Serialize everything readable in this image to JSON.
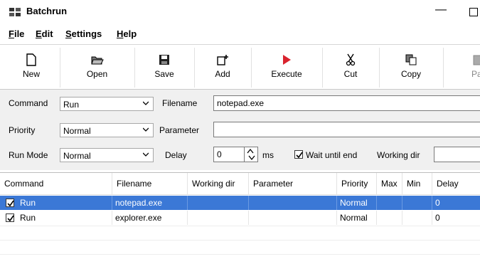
{
  "window": {
    "title": "Batchrun",
    "min_glyph": "—"
  },
  "menu": [
    {
      "label": "File",
      "key": "F",
      "rest": "ile"
    },
    {
      "label": "Edit",
      "key": "E",
      "rest": "dit"
    },
    {
      "label": "Settings",
      "key": "S",
      "rest": "ettings"
    },
    {
      "label": "Help",
      "key": "H",
      "rest": "elp"
    }
  ],
  "toolbar": {
    "new": "New",
    "open": "Open",
    "save": "Save",
    "add": "Add",
    "execute": "Execute",
    "cut": "Cut",
    "copy": "Copy",
    "paste": "Past"
  },
  "form": {
    "command_label": "Command",
    "command_value": "Run",
    "filename_label": "Filename",
    "filename_value": "notepad.exe",
    "priority_label": "Priority",
    "priority_value": "Normal",
    "parameter_label": "Parameter",
    "parameter_value": "",
    "runmode_label": "Run Mode",
    "runmode_value": "Normal",
    "delay_label": "Delay",
    "delay_value": "0",
    "delay_unit": "ms",
    "wait_label": "Wait until end",
    "wait_checked": true,
    "workdir_label": "Working dir",
    "workdir_value": ""
  },
  "table": {
    "columns": [
      "Command",
      "Filename",
      "Working dir",
      "Parameter",
      "Priority",
      "Max",
      "Min",
      "Delay"
    ],
    "rows": [
      {
        "command": "Run",
        "filename": "notepad.exe",
        "workdir": "",
        "parameter": "",
        "priority": "Normal",
        "max": "",
        "min": "",
        "delay": "0",
        "checked": true,
        "selected": true
      },
      {
        "command": "Run",
        "filename": "explorer.exe",
        "workdir": "",
        "parameter": "",
        "priority": "Normal",
        "max": "",
        "min": "",
        "delay": "0",
        "checked": true,
        "selected": false
      }
    ]
  },
  "colors": {
    "selection": "#3b78d6",
    "form_bg": "#f0f0f0",
    "execute_icon": "#d9232e"
  }
}
